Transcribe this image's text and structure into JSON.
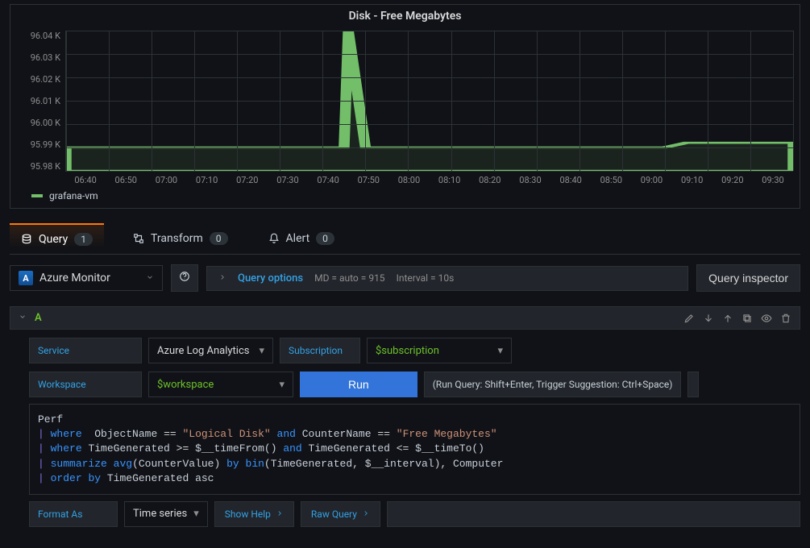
{
  "chart_data": {
    "type": "line",
    "title": "Disk - Free Megabytes",
    "series_name": "grafana-vm",
    "ylim": [
      95.98,
      96.04
    ],
    "y_ticks": [
      "96.04 K",
      "96.03 K",
      "96.02 K",
      "96.01 K",
      "96.00 K",
      "95.99 K",
      "95.98 K"
    ],
    "x_ticks": [
      "06:40",
      "06:50",
      "07:00",
      "07:10",
      "07:20",
      "07:30",
      "07:40",
      "07:50",
      "08:00",
      "08:10",
      "08:20",
      "08:30",
      "08:40",
      "08:50",
      "09:00",
      "09:10",
      "09:20",
      "09:30"
    ],
    "x": [
      "06:40",
      "06:50",
      "07:00",
      "07:10",
      "07:20",
      "07:30",
      "07:40",
      "07:45",
      "07:46",
      "07:50",
      "08:00",
      "08:10",
      "08:20",
      "08:30",
      "08:40",
      "08:50",
      "09:00",
      "09:05",
      "09:10",
      "09:20",
      "09:30"
    ],
    "values": [
      95.99,
      95.99,
      95.99,
      95.99,
      95.99,
      95.99,
      95.99,
      95.99,
      96.04,
      95.99,
      95.99,
      95.99,
      95.99,
      95.99,
      95.99,
      95.99,
      95.99,
      95.992,
      95.992,
      95.992,
      95.992
    ]
  },
  "tabs": {
    "query": {
      "label": "Query",
      "count": "1"
    },
    "transform": {
      "label": "Transform",
      "count": "0"
    },
    "alert": {
      "label": "Alert",
      "count": "0"
    }
  },
  "datasource": {
    "name": "Azure Monitor"
  },
  "query_options": {
    "label": "Query options",
    "md": "MD = auto = 915",
    "interval": "Interval = 10s"
  },
  "inspector": {
    "label": "Query inspector"
  },
  "query_row": {
    "ref_id": "A"
  },
  "fields": {
    "service": {
      "label": "Service",
      "value": "Azure Log Analytics"
    },
    "subscription": {
      "label": "Subscription",
      "value": "$subscription"
    },
    "workspace": {
      "label": "Workspace",
      "value": "$workspace"
    },
    "run": {
      "label": "Run",
      "hint": "(Run Query: Shift+Enter, Trigger Suggestion: Ctrl+Space)"
    },
    "format_as": {
      "label": "Format As",
      "value": "Time series"
    },
    "show_help": {
      "label": "Show Help"
    },
    "raw_query": {
      "label": "Raw Query"
    }
  },
  "code": "Perf\n| where  ObjectName == \"Logical Disk\" and CounterName == \"Free Megabytes\"\n| where TimeGenerated >= $__timeFrom() and TimeGenerated <= $__timeTo()\n| summarize avg(CounterValue) by bin(TimeGenerated, $__interval), Computer\n| order by TimeGenerated asc"
}
